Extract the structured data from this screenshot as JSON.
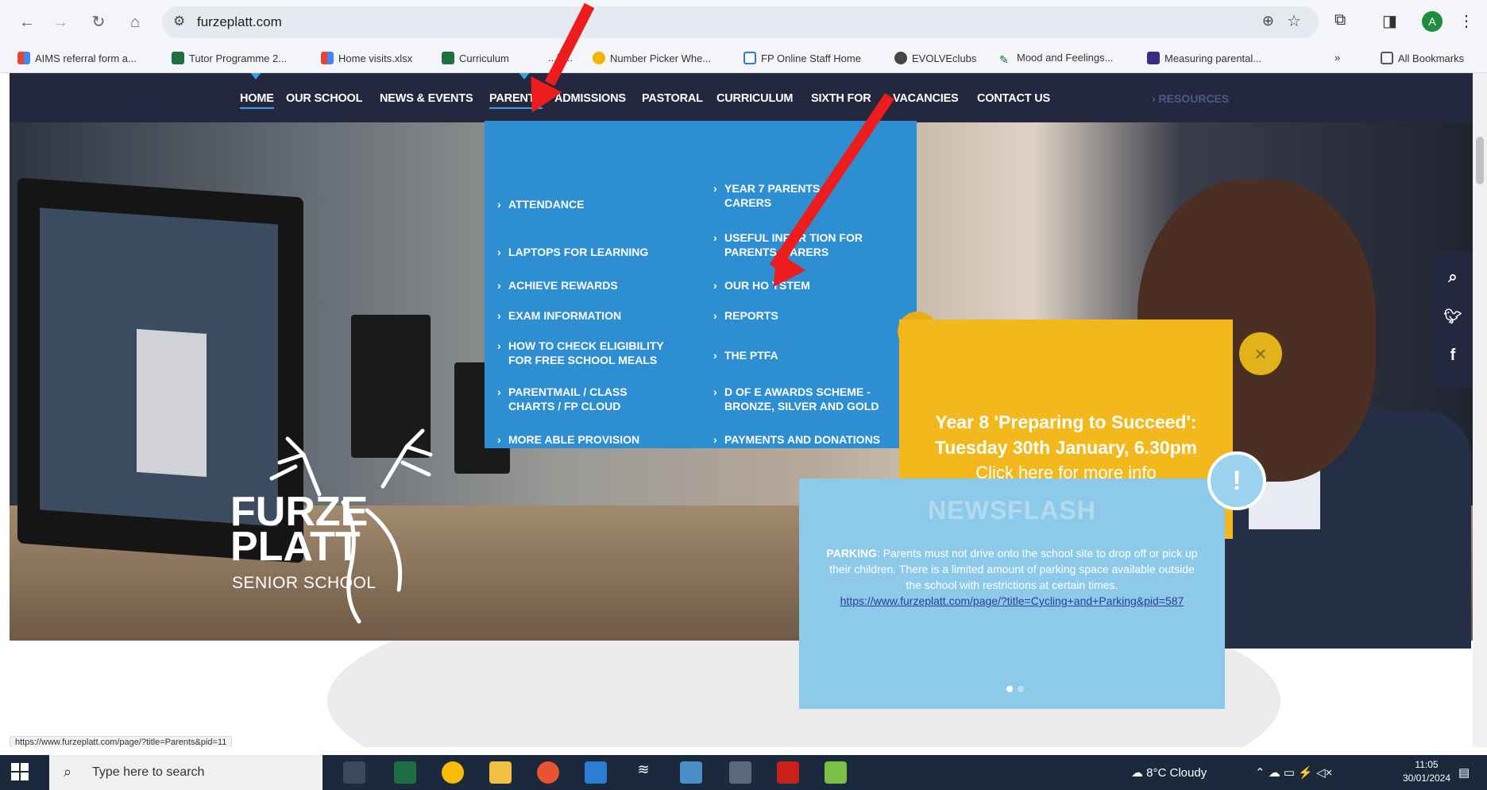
{
  "browser": {
    "url": "furzeplatt.com",
    "bookmarks": [
      "AIMS referral form a...",
      "Tutor Programme 2...",
      "Home visits.xlsx",
      "Curriculum",
      "...D...",
      "Number Picker Whe...",
      "FP Online Staff Home",
      "EVOLVEclubs",
      "Mood and Feelings...",
      "Measuring parental..."
    ],
    "bookmarks_more": "»",
    "all_bookmarks": "All Bookmarks",
    "avatar_letter": "A",
    "status_url": "https://www.furzeplatt.com/page/?title=Parents&pid=11"
  },
  "nav": {
    "items": [
      "HOME",
      "OUR SCHOOL",
      "NEWS & EVENTS",
      "PARENTS",
      "ADMISSIONS",
      "PASTORAL",
      "CURRICULUM",
      "SIXTH FOR",
      "VACANCIES",
      "CONTACT US"
    ],
    "resources": "› RESOURCES"
  },
  "dropdown": {
    "left": [
      "ATTENDANCE",
      "LAPTOPS FOR LEARNING",
      "ACHIEVE REWARDS",
      "EXAM INFORMATION",
      "HOW TO CHECK ELIGIBILITY FOR FREE SCHOOL MEALS",
      "PARENTMAIL / CLASS CHARTS / FP CLOUD",
      "MORE ABLE PROVISION"
    ],
    "right": [
      "YEAR 7 PARENTS A CARERS",
      "USEFUL INFOR TION FOR PARENTS A ARERS",
      "OUR HO YSTEM",
      "REPORTS",
      "THE PTFA",
      "D OF E AWARDS SCHEME - BRONZE, SILVER AND GOLD",
      "PAYMENTS AND DONATIONS"
    ]
  },
  "crest": {
    "line1": "FURZE",
    "line2": "PLATT",
    "line3": "SENIOR SCHOOL"
  },
  "promo": {
    "line1": "Year 8 'Preparing to Succeed':",
    "line2": "Tuesday 30th January, 6.30pm",
    "line3": "Click here for more info",
    "close": "×"
  },
  "newsflash": {
    "title": "NEWSFLASH",
    "badge": "!",
    "label": "PARKING",
    "text": ": Parents must not drive onto the school site to drop off or pick up their children. There is a limited amount of parking space available outside the school with restrictions at certain times.",
    "link": "https://www.furzeplatt.com/page/?title=Cycling+and+Parking&pid=587"
  },
  "taskbar": {
    "search_placeholder": "Type here to search",
    "weather": "8°C  Cloudy",
    "time": "11:05",
    "date": "30/01/2024"
  },
  "colors": {
    "nav_bg": "#23283f",
    "dropdown_bg": "#2d8ed1",
    "promo_bg": "#f2b81c",
    "newsflash_bg": "#8dcaea",
    "arrow": "#ee1c1c"
  }
}
